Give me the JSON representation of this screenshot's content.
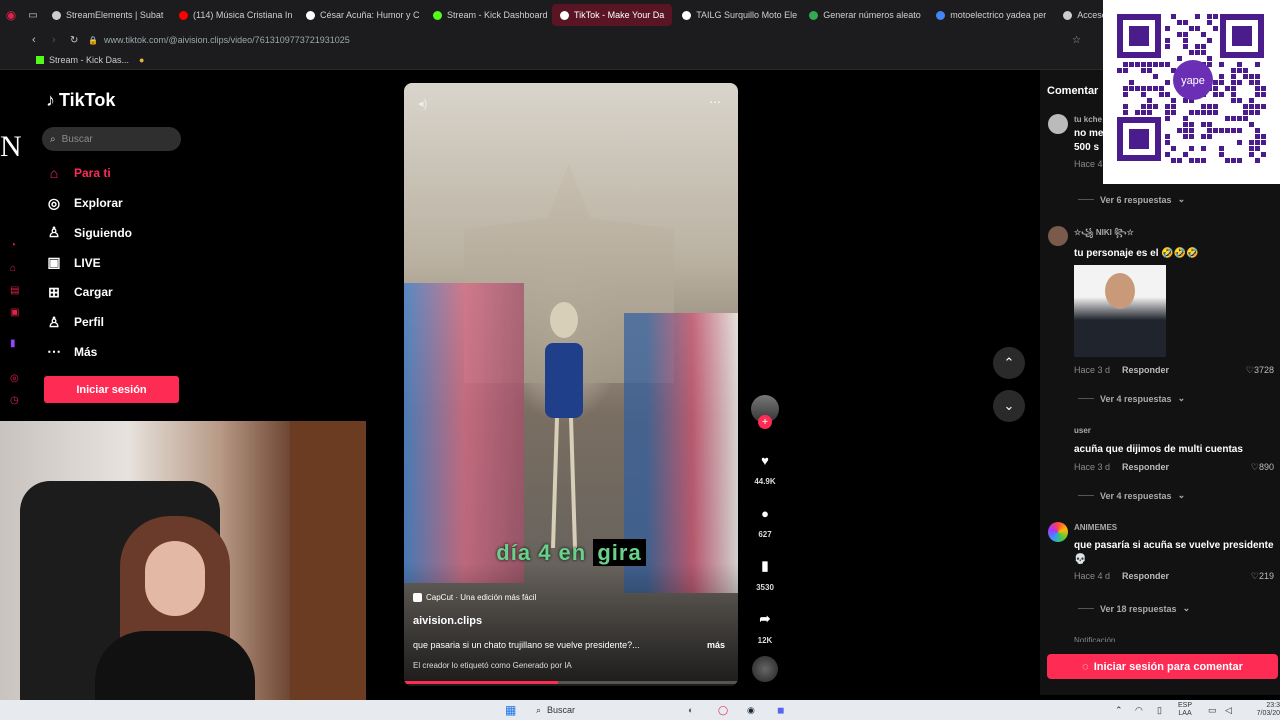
{
  "browser": {
    "tabs": [
      {
        "label": "StreamElements | Subat",
        "color": "#cccccc",
        "active": false
      },
      {
        "label": "(114) Música Cristiana In",
        "color": "#ff0000",
        "active": false
      },
      {
        "label": "César Acuña: Humor y C",
        "color": "#ffffff",
        "active": false
      },
      {
        "label": "Stream - Kick Dashboard",
        "color": "#53fc18",
        "active": false
      },
      {
        "label": "TikTok - Make Your Da",
        "color": "#ffffff",
        "active": true
      },
      {
        "label": "TAILG Surquillo Moto Ele",
        "color": "#ffffff",
        "active": false
      },
      {
        "label": "Generar números aleato",
        "color": "#34a853",
        "active": false
      },
      {
        "label": "motoelectrico yadea per",
        "color": "#4285f4",
        "active": false
      },
      {
        "label": "Acceso",
        "color": "#cccccc",
        "active": false
      }
    ],
    "url": "www.tiktok.com/@aivision.clips/video/7613109773721931025",
    "bookmarks": [
      "Stream - Kick Das..."
    ]
  },
  "sidebar": {
    "brand": "TikTok",
    "search_placeholder": "Buscar",
    "nav": [
      {
        "label": "Para ti",
        "icon": "home-icon",
        "active": true
      },
      {
        "label": "Explorar",
        "icon": "compass-icon",
        "active": false
      },
      {
        "label": "Siguiendo",
        "icon": "following-icon",
        "active": false
      },
      {
        "label": "LIVE",
        "icon": "live-icon",
        "active": false
      },
      {
        "label": "Cargar",
        "icon": "upload-icon",
        "active": false
      },
      {
        "label": "Perfil",
        "icon": "profile-icon",
        "active": false
      },
      {
        "label": "Más",
        "icon": "more-icon",
        "active": false
      }
    ],
    "login_button": "Iniciar sesión"
  },
  "external_letter": "N",
  "video": {
    "overlay_caption_1": "día 4 en",
    "overlay_caption_2": "gira",
    "capcut_tag": "CapCut · Una edición más fácil",
    "author": "aivision.clips",
    "description": "que pasaria si un chato trujillano se vuelve presidente?...",
    "more": "más",
    "ai_label": "El creador lo etiquetó como Generado por IA",
    "progress": 0.46
  },
  "actions": {
    "likes": "44.9K",
    "comments": "627",
    "saves": "3530",
    "shares": "12K"
  },
  "comments_panel": {
    "title": "Comentar",
    "items": [
      {
        "user": "tu kche",
        "text_1": "no me",
        "text_2": "500 s",
        "time": "Hace 4",
        "replies": "Ver 6 respuestas",
        "avatar": "#bbbbbb"
      },
      {
        "user": "☆꧁ NIKI ꧂☆",
        "text_1": "tu personaje es el 🤣🤣🤣",
        "time": "Hace 3 d",
        "reply": "Responder",
        "likes": "3728",
        "replies": "Ver 4 respuestas",
        "avatar": "#7a5a4a"
      },
      {
        "user": "user",
        "text_1": "acuña que dijimos de multi cuentas",
        "time": "Hace 3 d",
        "reply": "Responder",
        "likes": "890",
        "replies": "Ver 4 respuestas",
        "avatar": "#121212"
      },
      {
        "user": "ANIMEMES",
        "text_1": "que pasaría si acuña se vuelve presidente",
        "text_2": "💀",
        "time": "Hace 4 d",
        "reply": "Responder",
        "likes": "219",
        "replies": "Ver 18 respuestas",
        "avatar": "#4caf50"
      }
    ],
    "next_user": "Notificación",
    "login_button": "Iniciar sesión para comentar"
  },
  "qr": {
    "logo": "yape"
  },
  "taskbar": {
    "search": "Buscar",
    "lang_1": "ESP",
    "lang_2": "LAA",
    "time": "23:3",
    "date": "7/03/20"
  }
}
